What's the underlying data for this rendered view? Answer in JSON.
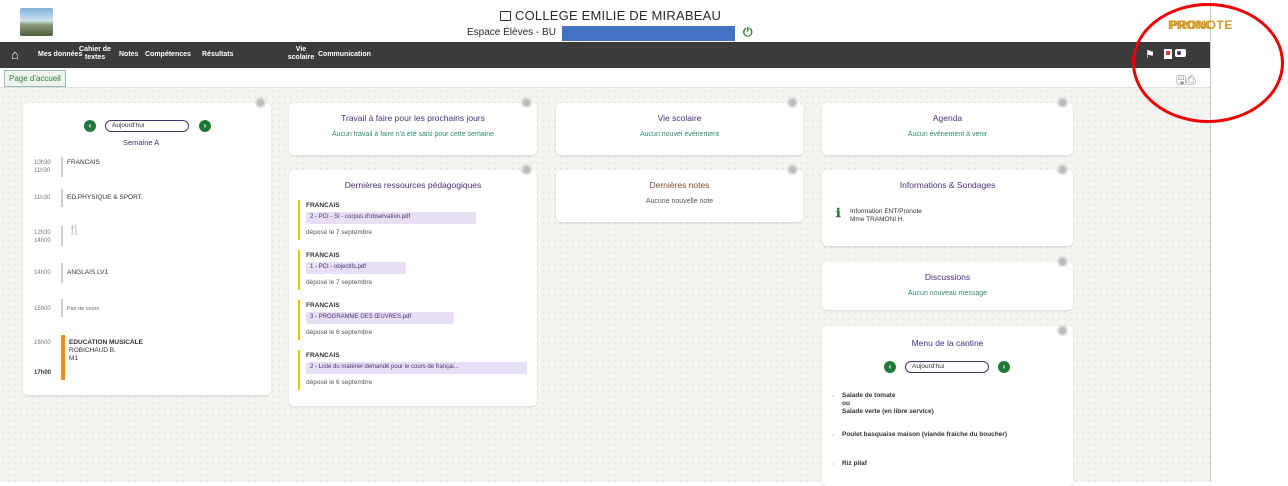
{
  "header": {
    "school_name": "COLLEGE EMILIE DE MIRABEAU",
    "space_label": "Espace Élèves - BU",
    "brand": "PRONOTE"
  },
  "nav": {
    "items": [
      {
        "label": "Mes données"
      },
      {
        "label": "Cahier de textes"
      },
      {
        "label": "Notes"
      },
      {
        "label": "Compétences"
      },
      {
        "label": "Résultats"
      },
      {
        "label": "Vie scolaire"
      },
      {
        "label": "Communication"
      }
    ]
  },
  "tab": {
    "label": "Page d'accueil"
  },
  "timetable": {
    "date_value": "Aujourd'hui",
    "week": "Semaine A",
    "lessons": [
      {
        "start": "10h30",
        "end": "11h30",
        "subject": "FRANCAIS"
      },
      {
        "start": "11h30",
        "end": "",
        "subject": "ED.PHYSIQUE & SPORT."
      },
      {
        "start": "12h30",
        "end": "14h00",
        "subject": "🍴"
      },
      {
        "start": "14h00",
        "end": "",
        "subject": "ANGLAIS LV1"
      },
      {
        "start": "15h00",
        "end": "",
        "subject": "Pas de cours"
      },
      {
        "start": "16h00",
        "end": "17h00",
        "subject": "EDUCATION MUSICALE",
        "teacher": "ROBICHAUD B.",
        "room": "M1"
      }
    ]
  },
  "travail": {
    "title": "Travail à faire pour les prochains jours",
    "empty": "Aucun travail à faire n'a été saisi pour cette semaine"
  },
  "ressources": {
    "title": "Dernières ressources pédagogiques",
    "items": [
      {
        "subject": "FRANCAIS",
        "file": "2 - PCI - SI - corpus d'observation.pdf",
        "date": "déposé le 7 septembre"
      },
      {
        "subject": "FRANCAIS",
        "file": "1 - PCI - objectifs.pdf",
        "date": "déposé le 7 septembre"
      },
      {
        "subject": "FRANCAIS",
        "file": "3 - PROGRAMME DES ŒUVRES.pdf",
        "date": "déposé le 6 septembre"
      },
      {
        "subject": "FRANCAIS",
        "file": "2 - Liste du matériel demandé pour le cours de françai...",
        "date": "déposé le 6 septembre"
      }
    ]
  },
  "vie_scolaire": {
    "title": "Vie scolaire",
    "empty": "Aucun nouvel évènement"
  },
  "notes": {
    "title": "Dernières notes",
    "empty": "Aucune nouvelle note"
  },
  "agenda": {
    "title": "Agenda",
    "empty": "Aucun évènement à venir"
  },
  "infos": {
    "title": "Informations & Sondages",
    "item_title": "Information ENT/Pronote",
    "item_author": "Mme TRAMONI H."
  },
  "discussions": {
    "title": "Discussions",
    "empty": "Aucun nouveau message"
  },
  "cantine": {
    "title": "Menu de la cantine",
    "date_value": "Aujourd'hui",
    "line1": "Salade de tomate",
    "or": "ou",
    "line2": "Salade verte (en libre service)",
    "line3": "Poulet basquaise maison (viande fraiche du boucher)",
    "line4": "Riz pilaf"
  },
  "colors": {
    "accent": "#4a2e7a",
    "green": "#1f7a3a",
    "nav_bg": "#3b3b3b",
    "annotation": "#e00000",
    "redaction": "#4472c4"
  }
}
